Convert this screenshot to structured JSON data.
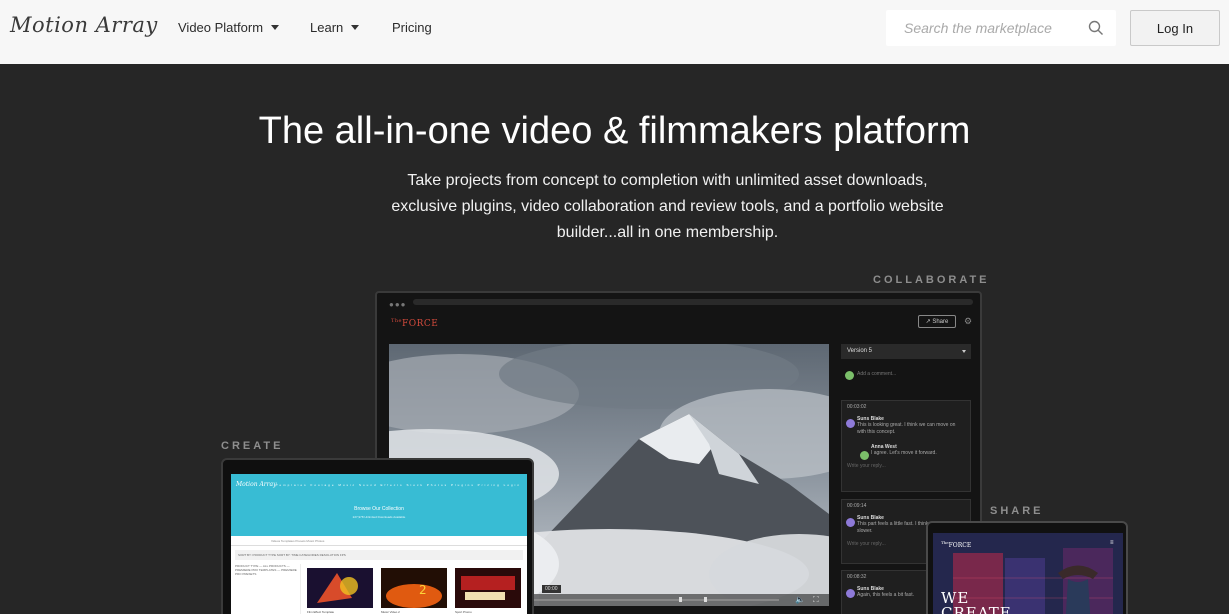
{
  "nav": {
    "logo": "Motion Array",
    "items": [
      {
        "label": "Video Platform",
        "dropdown": true
      },
      {
        "label": "Learn",
        "dropdown": true
      },
      {
        "label": "Pricing",
        "dropdown": false
      }
    ],
    "search_placeholder": "Search the marketplace",
    "login_label": "Log In"
  },
  "hero": {
    "title": "The all-in-one video & filmmakers platform",
    "subtitle": "Take projects from concept to completion with unlimited asset downloads, exclusive plugins, video collaboration and review tools, and a portfolio website builder...all in one membership."
  },
  "labels": {
    "collaborate": "COLLABORATE",
    "create": "CREATE",
    "share": "SHARE"
  },
  "collab_app": {
    "brand": "FORCE",
    "share_button": "Share",
    "version": "Version 5",
    "add_comment": "Add a comment...",
    "timecode": "00:00",
    "comments": [
      {
        "time": "00:03:02",
        "author": "Suns Blake",
        "text": "This is looking great. I think we can move on with this concept.",
        "reply_author": "Anna West",
        "reply_text": "I agree. Let's move it forward.",
        "reply_hint": "Write your reply..."
      },
      {
        "time": "00:09:14",
        "author": "Suns Blake",
        "text": "This part feels a little fast. I think we can make it slower.",
        "reply_hint": "Write your reply..."
      },
      {
        "time": "00:08:32",
        "author": "Suns Blake",
        "text": "Again, this feels a bit fast."
      }
    ]
  },
  "create_app": {
    "logo": "Motion Array",
    "nav_links": "Templates  Footage  Music  Sound Effects  Stock Photos  Plugins  Pricing  Login",
    "heading": "Browse Our Collection",
    "subheading": "227,978 Unlimited Downloads Available",
    "tabs": "Videos  Templates  Presets  Music  Photos",
    "filter": "SORT BY: PRODUCT TYPE   SORT BY: TIME   CATEGORIES   RESOLUTION   FPS",
    "sidebar": "PRODUCT TYPE  —  ALL PRODUCTS  —  PREMIERE PRO TEMPLATES  —  PREMIERE PRO PRESETS",
    "thumbs": [
      {
        "caption": "Film Effect Template",
        "colors": [
          "#1a1030",
          "#d84b2a",
          "#f0c020"
        ]
      },
      {
        "caption": "Music Video 2",
        "colors": [
          "#220e05",
          "#e05a10",
          "#fcd43a"
        ]
      },
      {
        "caption": "Sport Promo",
        "colors": [
          "#2a0a0a",
          "#b52020",
          "#f0e0b0"
        ]
      }
    ]
  },
  "share_app": {
    "brand": "FORCE",
    "headline": "WE CREATE"
  }
}
